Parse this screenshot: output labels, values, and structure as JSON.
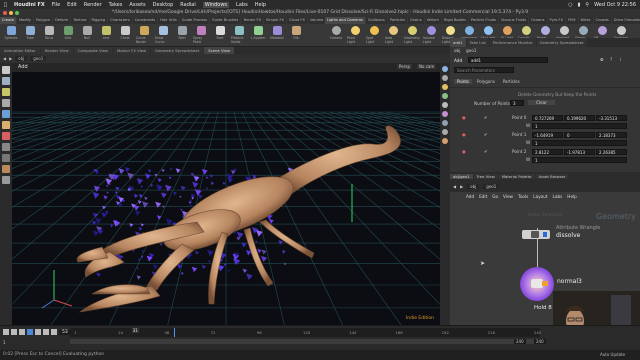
{
  "menubar": {
    "app": "Houdini FX",
    "items": [
      "File",
      "Edit",
      "Render",
      "Takes",
      "Assets",
      "Desktop",
      "Radial",
      "Windows",
      "Labs",
      "Help"
    ],
    "active": "Windows",
    "clock": "Wed Oct 9 22:56"
  },
  "titlebar": "*/Users/lorikasea/nd/me/Google Drive/LiHi/Projects/[OTS] HoudiniHowtos/Houdini Files/Live-0107 Grid Dissolve/Sci-Fi Dissolve2.hiplc - Houdini Indie Limited-Commercial 19.5.374 - Py3.9",
  "shelf": {
    "tabs": [
      "Create",
      "Modify",
      "Polygon",
      "Deform",
      "Texture",
      "Rigging",
      "Characters",
      "Constraints",
      "Hair Utils",
      "Guide Process",
      "Guide Brushes",
      "Terrain FX",
      "Simple FX",
      "Cloud FX",
      "Volume"
    ],
    "tools": [
      "Spheres",
      "Tube",
      "Torus",
      "Grid",
      "Null",
      "Line",
      "Circle",
      "Curve Bezier",
      "Draw Curve",
      "Path",
      "Spray Paint",
      "Font",
      "Platonic Solids",
      "L-System",
      "Metaball",
      "File"
    ],
    "lights_tabs": [
      "Lights and Cameras",
      "Collisions",
      "Particles",
      "Grains",
      "Vellum",
      "Rigid Bodies",
      "Particle Fluids",
      "Viscous Fluids",
      "Oceans",
      "Pyro FX",
      "FEM",
      "Wires",
      "Crowds",
      "Drive Simulation"
    ],
    "light_tools": [
      "Camera",
      "Point Light",
      "Spot Light",
      "Area Light",
      "Geometry Light",
      "Volume Light",
      "Distant Light",
      "Environment Light",
      "Sky Light",
      "GI Light",
      "Caustic Light",
      "Portal Light",
      "Ambient Light",
      "Stereo Camera",
      "VR Camera",
      "Switcher"
    ]
  },
  "viewport_tabs": [
    "Animation Editor",
    "Render View",
    "Composite View",
    "Motion FX View",
    "Geometry Spreadsheet",
    "Scene View"
  ],
  "viewport_active": "Scene View",
  "viewport_path": [
    "obj",
    "geo1"
  ],
  "viewport_node": "Add",
  "viewport_persp": "Persp",
  "viewport_cam": "No cam",
  "viewport_badge": "Indie Edition",
  "timeline": {
    "frame": "53",
    "start": "1",
    "end": "240",
    "range_end": "240",
    "ticks": [
      "1",
      "24",
      "48",
      "72",
      "96",
      "120",
      "144",
      "168",
      "192",
      "216",
      "240"
    ],
    "marker": "31"
  },
  "status": "0:02 [Press Esc to Cancel] Evaluating python",
  "auto_update": "Auto Update",
  "param_tabs": [
    "add1",
    "Take List",
    "Performance Monitor",
    "Geometry Spreadsheet"
  ],
  "params": {
    "path": [
      "obj",
      "geo1"
    ],
    "node_type": "Add",
    "node_name": "add1",
    "search_placeholder": "Search Parameters",
    "subtabs": [
      "Points",
      "Polygons",
      "Particles"
    ],
    "delete_label": "Delete Geometry But Keep the Points",
    "num_points_label": "Number of Points",
    "num_points": "3",
    "clear_label": "Clear",
    "points": [
      {
        "label": "Point 0",
        "x": "0.727269",
        "y": "0.199620",
        "z": "-3.31513",
        "w": "1"
      },
      {
        "label": "Point 1",
        "x": "-1.64919",
        "y": "0",
        "z": "2.18373",
        "w": "1"
      },
      {
        "label": "Point 2",
        "x": "2.8122",
        "y": "-1.97813",
        "z": "2.26385",
        "w": "1"
      }
    ]
  },
  "network": {
    "tabs": [
      "obj/geo1",
      "Tree View",
      "Material Palette",
      "Asset Browser"
    ],
    "path": [
      "obj",
      "geo1"
    ],
    "menu": [
      "Add",
      "Edit",
      "Go",
      "View",
      "Tools",
      "Layout",
      "Labs",
      "Help"
    ],
    "context": "Geometry",
    "nodes": [
      {
        "type": "Attribute Wrangle",
        "name": "dissolve"
      },
      {
        "type": "",
        "name": "normal3"
      }
    ],
    "faded_node": "Index Selection",
    "hint": "Hold 8 or Pad8 to disable d"
  },
  "colors": {
    "accent": "#f7a02b",
    "node_purple": "#8a4de0",
    "grid": "#2a6060",
    "scorpion": "#c59a74"
  }
}
